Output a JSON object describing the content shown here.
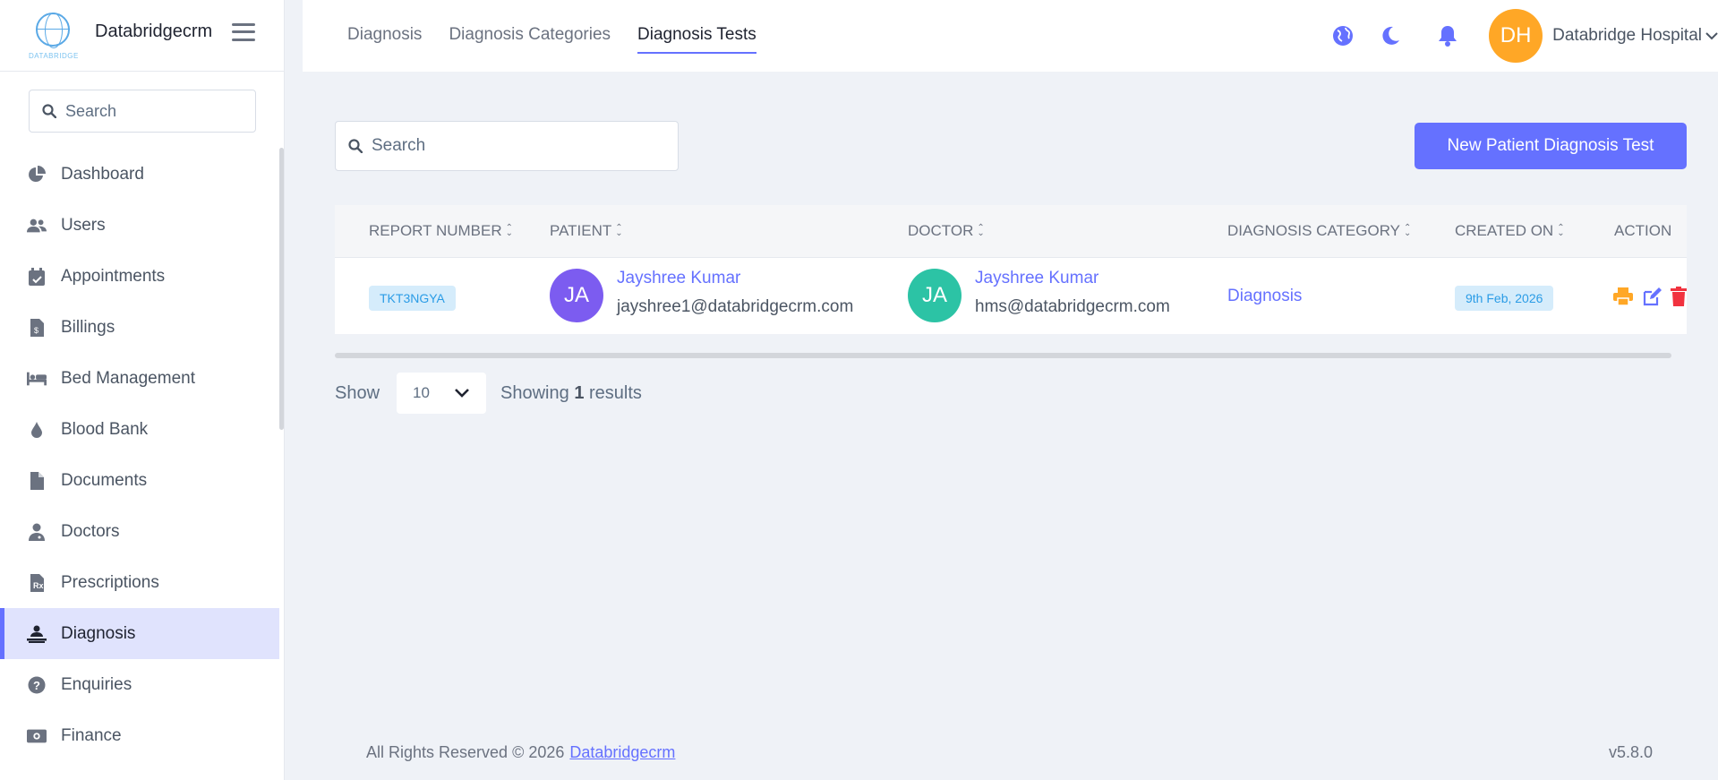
{
  "brand": {
    "name": "Databridgecrm",
    "logo_text": "DATABRIDGE"
  },
  "sidebar": {
    "search_placeholder": "Search",
    "items": [
      {
        "label": "Dashboard",
        "icon": "chart-pie-icon"
      },
      {
        "label": "Users",
        "icon": "users-icon"
      },
      {
        "label": "Appointments",
        "icon": "calendar-check-icon"
      },
      {
        "label": "Billings",
        "icon": "file-invoice-icon"
      },
      {
        "label": "Bed Management",
        "icon": "bed-icon"
      },
      {
        "label": "Blood Bank",
        "icon": "tint-icon"
      },
      {
        "label": "Documents",
        "icon": "file-icon"
      },
      {
        "label": "Doctors",
        "icon": "user-doctor-icon"
      },
      {
        "label": "Prescriptions",
        "icon": "file-prescription-icon"
      },
      {
        "label": "Diagnosis",
        "icon": "diagnoses-icon",
        "active": true
      },
      {
        "label": "Enquiries",
        "icon": "question-circle-icon"
      },
      {
        "label": "Finance",
        "icon": "money-bill-icon"
      }
    ]
  },
  "header": {
    "tabs": [
      "Diagnosis",
      "Diagnosis Categories",
      "Diagnosis Tests"
    ],
    "active_tab": "Diagnosis Tests",
    "user_initials": "DH",
    "user_name": "Databridge Hospital"
  },
  "main": {
    "search_placeholder": "Search",
    "new_button": "New Patient Diagnosis Test",
    "columns": [
      "REPORT NUMBER",
      "PATIENT",
      "DOCTOR",
      "DIAGNOSIS CATEGORY",
      "CREATED ON",
      "ACTION"
    ],
    "rows": [
      {
        "report_number": "TKT3NGYA",
        "patient_initials": "JA",
        "patient_name": "Jayshree Kumar",
        "patient_email": "jayshree1@databridgecrm.com",
        "doctor_initials": "JA",
        "doctor_name": "Jayshree Kumar",
        "doctor_email": "hms@databridgecrm.com",
        "category": "Diagnosis",
        "created_on": "9th Feb, 2026"
      }
    ],
    "show_label": "Show",
    "per_page": "10",
    "showing_prefix": "Showing",
    "showing_count": "1",
    "showing_suffix": "results"
  },
  "footer": {
    "text": "All Rights Reserved © 2026",
    "link": "Databridgecrm",
    "version": "v5.8.0"
  },
  "colors": {
    "accent": "#6571ff",
    "patient_avatar": "#7c5cf0",
    "doctor_avatar": "#2cc3a5",
    "user_avatar": "#ffa726",
    "print_icon": "#ffa726",
    "edit_icon": "#6571ff",
    "delete_icon": "#f1323f"
  }
}
